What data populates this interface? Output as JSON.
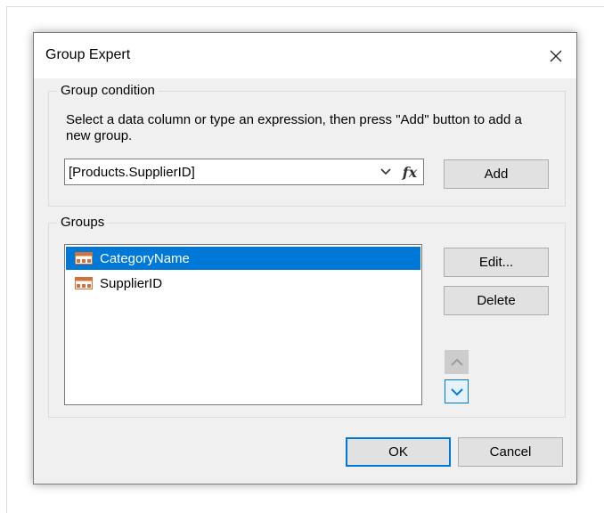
{
  "dialog": {
    "title": "Group Expert",
    "close_icon": "close-icon"
  },
  "group_condition": {
    "legend": "Group condition",
    "instruction": "Select a data column or type an expression, then press \"Add\" button to add a new group.",
    "expression_value": "[Products.SupplierID]",
    "dropdown_icon": "chevron-down-icon",
    "fx_label": "fx",
    "add_label": "Add"
  },
  "groups": {
    "legend": "Groups",
    "items": [
      {
        "label": "CategoryName",
        "icon": "group-table-icon",
        "selected": true
      },
      {
        "label": "SupplierID",
        "icon": "group-table-icon",
        "selected": false
      }
    ],
    "edit_label": "Edit...",
    "delete_label": "Delete",
    "move_up_icon": "chevron-up-icon",
    "move_down_icon": "chevron-down-icon"
  },
  "footer": {
    "ok_label": "OK",
    "cancel_label": "Cancel"
  },
  "colors": {
    "selection": "#0078d7",
    "dialog_bg": "#f0f0f0",
    "icon_orange": "#d0703a"
  }
}
